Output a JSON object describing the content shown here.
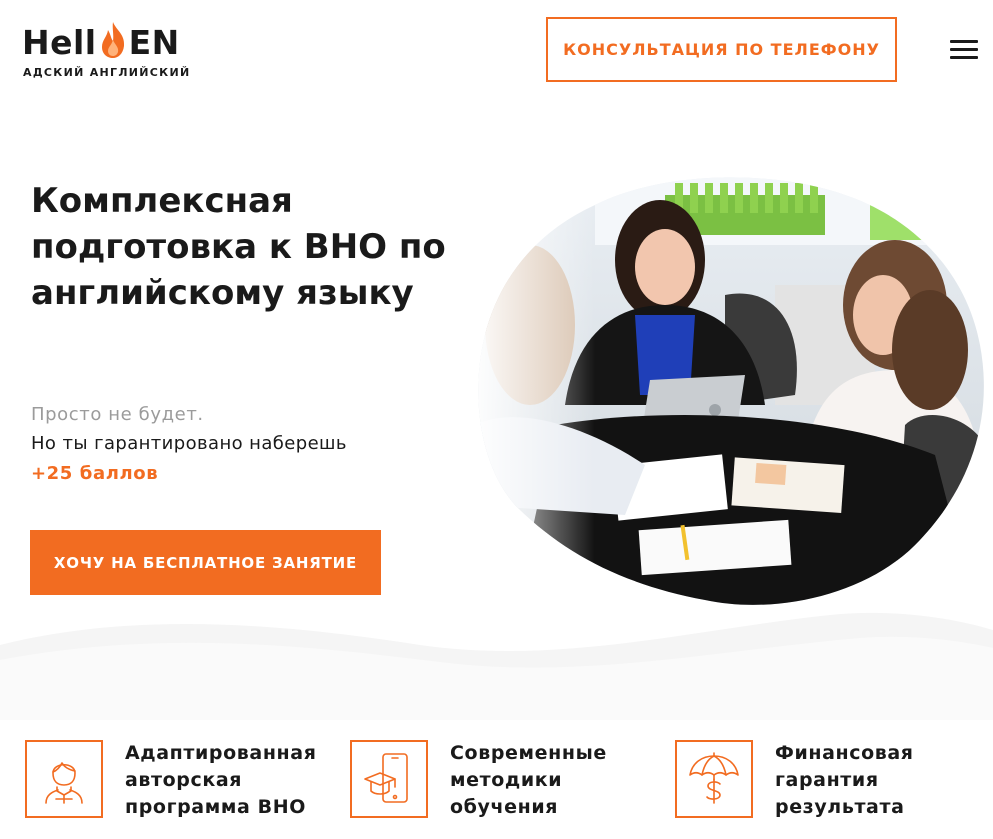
{
  "header": {
    "logo_left": "Hell",
    "logo_right": "EN",
    "logo_tagline": "АДСКИЙ АНГЛИЙСКИЙ",
    "phone_button_label": "КОНСУЛЬТАЦИЯ ПО ТЕЛЕФОНУ"
  },
  "hero": {
    "title": "Комплексная подготовка к ВНО по английскому языку",
    "subtitle_line1": "Просто не будет.",
    "subtitle_line2": "Но ты гарантировано наберешь",
    "subtitle_highlight": "+25 баллов",
    "cta_label": "ХОЧУ НА БЕСПЛАТНОЕ ЗАНЯТИЕ"
  },
  "features": [
    {
      "icon": "student-icon",
      "text": "Адаптированная\nавторская\nпрограмма ВНО"
    },
    {
      "icon": "mobile-learning-icon",
      "text": "Современные\nметодики\nобучения"
    },
    {
      "icon": "money-umbrella-icon",
      "text": "Финансовая\nгарантия\nрезультата"
    }
  ],
  "colors": {
    "accent": "#f26c21",
    "text": "#1a1a1a",
    "muted": "#9b9b9b"
  }
}
